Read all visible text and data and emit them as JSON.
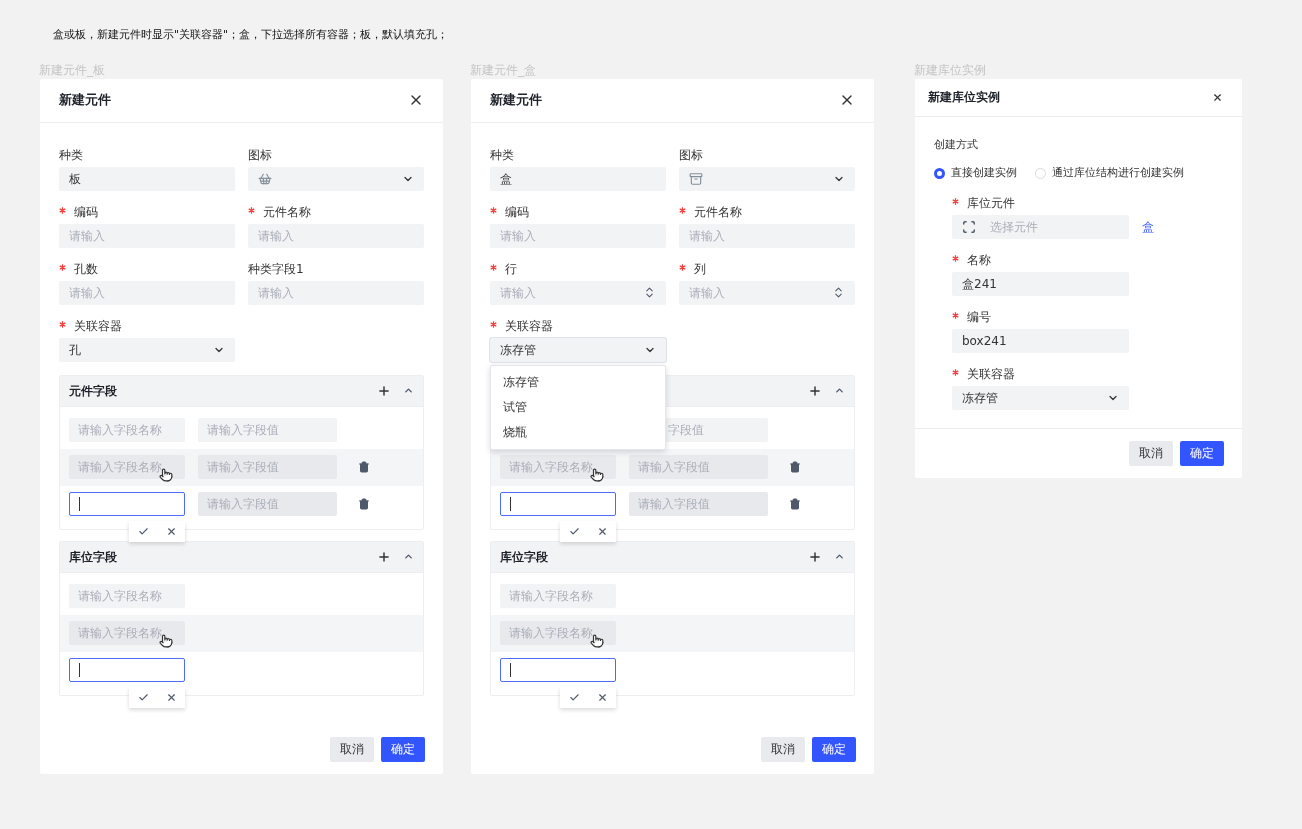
{
  "note": "盒或板，新建元件时显示\"关联容器\"；盒，下拉选择所有容器；板，默认填充孔；",
  "frames": [
    {
      "kind": "component",
      "caption": "新建元件_板",
      "title": "新建元件",
      "fields": [
        {
          "kind": "text",
          "label": "种类",
          "required": false,
          "value": "板"
        },
        {
          "kind": "icon-select",
          "label": "图标",
          "required": false
        },
        {
          "kind": "input",
          "label": "编码",
          "required": true,
          "placeholder": "请输入"
        },
        {
          "kind": "input",
          "label": "元件名称",
          "required": true,
          "placeholder": "请输入"
        },
        {
          "kind": "input",
          "label": "孔数",
          "required": true,
          "placeholder": "请输入"
        },
        {
          "kind": "input",
          "label": "种类字段1",
          "required": false,
          "placeholder": "请输入"
        },
        {
          "kind": "select",
          "label": "关联容器",
          "required": true,
          "value": "孔",
          "expanded": false
        }
      ],
      "sections": [
        {
          "title": "元件字段",
          "rows": [
            {
              "kind": "idle",
              "name_placeholder": "请输入字段名称",
              "value_placeholder": "请输入字段值",
              "deletable": false
            },
            {
              "kind": "hover",
              "name_placeholder": "请输入字段名称",
              "value_placeholder": "请输入字段值",
              "deletable": true
            },
            {
              "kind": "editing",
              "value_placeholder": "请输入字段值",
              "deletable": true
            }
          ]
        },
        {
          "title": "库位字段",
          "rows": [
            {
              "kind": "idle",
              "name_placeholder": "请输入字段名称",
              "deletable": false
            },
            {
              "kind": "hover",
              "name_placeholder": "请输入字段名称",
              "deletable": false
            },
            {
              "kind": "editing",
              "deletable": false
            }
          ]
        }
      ],
      "buttons": [
        {
          "kind": "secondary",
          "label": "取消"
        },
        {
          "kind": "primary",
          "label": "确定"
        }
      ]
    },
    {
      "kind": "component",
      "caption": "新建元件_盒",
      "title": "新建元件",
      "fields": [
        {
          "kind": "text",
          "label": "种类",
          "required": false,
          "value": "盒"
        },
        {
          "kind": "icon-select",
          "label": "图标",
          "required": false
        },
        {
          "kind": "input",
          "label": "编码",
          "required": true,
          "placeholder": "请输入"
        },
        {
          "kind": "input",
          "label": "元件名称",
          "required": true,
          "placeholder": "请输入"
        },
        {
          "kind": "number",
          "label": "行",
          "required": true,
          "placeholder": "请输入"
        },
        {
          "kind": "number",
          "label": "列",
          "required": true,
          "placeholder": "请输入"
        },
        {
          "kind": "select",
          "label": "关联容器",
          "required": true,
          "value": "冻存管",
          "expanded": true,
          "options": [
            "冻存管",
            "试管",
            "烧瓶"
          ]
        }
      ],
      "sections": [
        {
          "rows": [
            {
              "kind": "idle",
              "value_placeholder": "字段值",
              "deletable": false
            },
            {
              "kind": "hover",
              "name_placeholder": "请输入字段名称",
              "value_placeholder": "请输入字段值",
              "deletable": true
            },
            {
              "kind": "editing",
              "value_placeholder": "请输入字段值",
              "deletable": true
            }
          ]
        },
        {
          "title": "库位字段",
          "rows": [
            {
              "kind": "idle",
              "name_placeholder": "请输入字段名称",
              "deletable": false
            },
            {
              "kind": "hover",
              "name_placeholder": "请输入字段名称",
              "deletable": false
            },
            {
              "kind": "editing",
              "deletable": false
            }
          ]
        }
      ],
      "buttons": [
        {
          "kind": "secondary",
          "label": "取消"
        },
        {
          "kind": "primary",
          "label": "确定"
        }
      ]
    },
    {
      "kind": "instance",
      "caption": "新建库位实例",
      "title": "新建库位实例",
      "method_label": "创建方式",
      "radios": [
        {
          "label": "直接创建实例",
          "selected": true
        },
        {
          "label": "通过库位结构进行创建实例",
          "selected": false
        }
      ],
      "fields": [
        {
          "kind": "picker",
          "label": "库位元件",
          "required": true,
          "placeholder": "选择元件",
          "link": "盒"
        },
        {
          "kind": "text",
          "label": "名称",
          "required": true,
          "value": "盒241"
        },
        {
          "kind": "text",
          "label": "编号",
          "required": true,
          "value": "box241"
        },
        {
          "kind": "select",
          "label": "关联容器",
          "required": true,
          "value": "冻存管",
          "expanded": false
        }
      ],
      "buttons": [
        {
          "kind": "secondary",
          "label": "取消"
        },
        {
          "kind": "primary",
          "label": "确定"
        }
      ]
    }
  ]
}
